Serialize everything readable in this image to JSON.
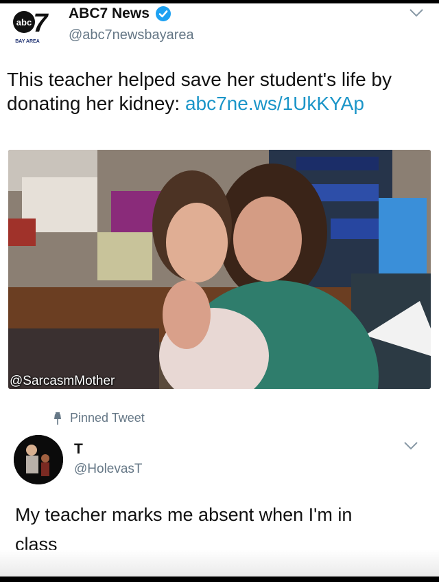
{
  "tweet1": {
    "account_name": "ABC7 News",
    "handle": "@abc7newsbayarea",
    "logo_text": "abc",
    "logo_number": "7",
    "logo_subtext": "BAY AREA",
    "text": "This teacher helped save her student's life by donating her kidney: ",
    "link": "abc7ne.ws/1UkKYAp",
    "media_watermark": "@SarcasmMother"
  },
  "pinned": {
    "label": "Pinned Tweet",
    "account_name": "T",
    "handle": "@HolevasT",
    "text": "My teacher marks me absent when I'm in class"
  },
  "icons": {
    "verified": "verified-badge-icon",
    "chevron": "chevron-down-icon",
    "pin": "pin-icon"
  },
  "colors": {
    "link": "#1b95c8",
    "verified": "#1da1f2",
    "secondary_text": "#657786"
  }
}
